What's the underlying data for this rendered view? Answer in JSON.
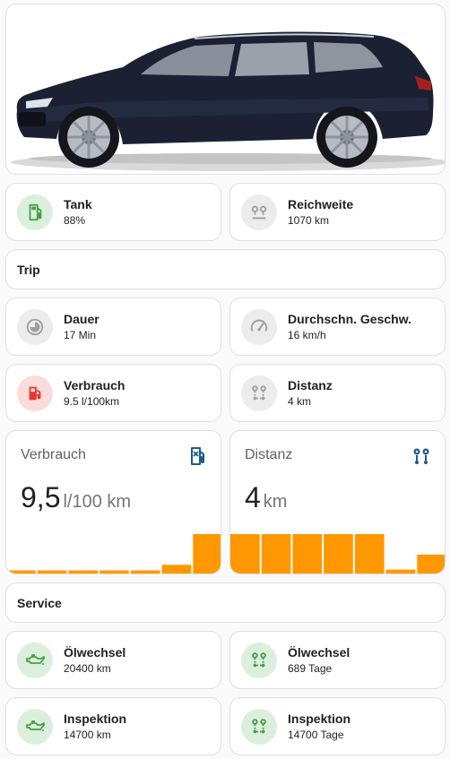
{
  "tiles": {
    "tank": {
      "name": "Tank",
      "state": "88%"
    },
    "range": {
      "name": "Reichweite",
      "state": "1070 km"
    },
    "duration": {
      "name": "Dauer",
      "state": "17 Min"
    },
    "avg_speed": {
      "name": "Durchschn. Geschw.",
      "state": "16 km/h"
    },
    "consumption": {
      "name": "Verbrauch",
      "state": "9.5 l/100km"
    },
    "distance": {
      "name": "Distanz",
      "state": "4 km"
    },
    "oil_km": {
      "name": "Ölwechsel",
      "state": "20400 km"
    },
    "oil_days": {
      "name": "Ölwechsel",
      "state": "689 Tage"
    },
    "insp_km": {
      "name": "Inspektion",
      "state": "14700 km"
    },
    "insp_days": {
      "name": "Inspektion",
      "state": "14700 Tage"
    }
  },
  "headings": {
    "trip": "Trip",
    "service": "Service"
  },
  "sensors": {
    "consumption": {
      "name": "Verbrauch",
      "value": "9,5",
      "unit": "l/100 km"
    },
    "distance": {
      "name": "Distanz",
      "value": "4",
      "unit": "km"
    }
  },
  "chart_data": [
    {
      "type": "bar",
      "series": [
        {
          "values": [
            0.08,
            0.08,
            0.08,
            0.08,
            0.08,
            0.22,
            1.0
          ]
        }
      ]
    },
    {
      "type": "bar",
      "series": [
        {
          "values": [
            1.0,
            1.0,
            1.0,
            1.0,
            1.0,
            0.1,
            0.48
          ]
        }
      ]
    }
  ],
  "colors": {
    "accent_green": "#43a047",
    "accent_red": "#e53935",
    "bar": "#ff9800",
    "icon_blue": "#1e5a8c",
    "icon_grey": "#9e9e9e"
  },
  "icons": {
    "tank": "gas-station-icon",
    "range": "map-marker-distance-icon",
    "duration": "timelapse-icon",
    "avg_speed": "speedometer-icon",
    "consumption": "fuel-pump-icon",
    "distance": "map-marker-path-icon",
    "oil": "oil-can-icon",
    "inspection": "map-marker-path-icon"
  }
}
